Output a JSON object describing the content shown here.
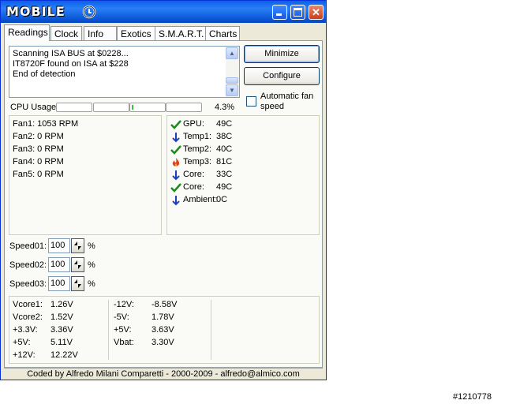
{
  "window": {
    "logo_text": "MOBILE"
  },
  "tabs": [
    "Readings",
    "Clock",
    "Info",
    "Exotics",
    "S.M.A.R.T.",
    "Charts"
  ],
  "log": {
    "lines": [
      "Scanning ISA BUS at $0228...",
      "IT8720F found on ISA at $228",
      "End of detection"
    ]
  },
  "buttons": {
    "minimize": "Minimize",
    "configure": "Configure"
  },
  "cpu": {
    "label": "CPU Usage",
    "value": "4.3%",
    "usage_fraction": 0.043
  },
  "auto_fan": {
    "label": "Automatic fan speed",
    "checked": false
  },
  "fans": [
    "Fan1: 1053 RPM",
    "Fan2: 0 RPM",
    "Fan3: 0 RPM",
    "Fan4: 0 RPM",
    "Fan5: 0 RPM"
  ],
  "temps": [
    {
      "name": "GPU:",
      "value": "49C",
      "icon": "check-icon",
      "color": "#1d8c1d"
    },
    {
      "name": "Temp1:",
      "value": "38C",
      "icon": "arrow-down-icon",
      "color": "#1f3fbf"
    },
    {
      "name": "Temp2:",
      "value": "40C",
      "icon": "check-icon",
      "color": "#1d8c1d"
    },
    {
      "name": "Temp3:",
      "value": "81C",
      "icon": "flame-icon",
      "color": "#e0401a"
    },
    {
      "name": "Core:",
      "value": "33C",
      "icon": "arrow-down-icon",
      "color": "#1f3fbf"
    },
    {
      "name": "Core:",
      "value": "49C",
      "icon": "check-icon",
      "color": "#1d8c1d"
    },
    {
      "name": "Ambient:",
      "value": "0C",
      "icon": "arrow-down-icon",
      "color": "#1f3fbf"
    }
  ],
  "speeds": [
    {
      "label": "Speed01:",
      "value": "100",
      "unit": "%"
    },
    {
      "label": "Speed02:",
      "value": "100",
      "unit": "%"
    },
    {
      "label": "Speed03:",
      "value": "100",
      "unit": "%"
    }
  ],
  "voltages_left": [
    {
      "name": "Vcore1:",
      "value": "1.26V"
    },
    {
      "name": "Vcore2:",
      "value": "1.52V"
    },
    {
      "name": "+3.3V:",
      "value": "3.36V"
    },
    {
      "name": "+5V:",
      "value": "5.11V"
    },
    {
      "name": "+12V:",
      "value": "12.22V"
    }
  ],
  "voltages_right": [
    {
      "name": "-12V:",
      "value": "-8.58V"
    },
    {
      "name": "-5V:",
      "value": "1.78V"
    },
    {
      "name": "+5V:",
      "value": "3.63V"
    },
    {
      "name": "Vbat:",
      "value": "3.30V"
    }
  ],
  "footer": "Coded by Alfredo Milani Comparetti - 2000-2009 - alfredo@almico.com",
  "watermark": "#1210778"
}
